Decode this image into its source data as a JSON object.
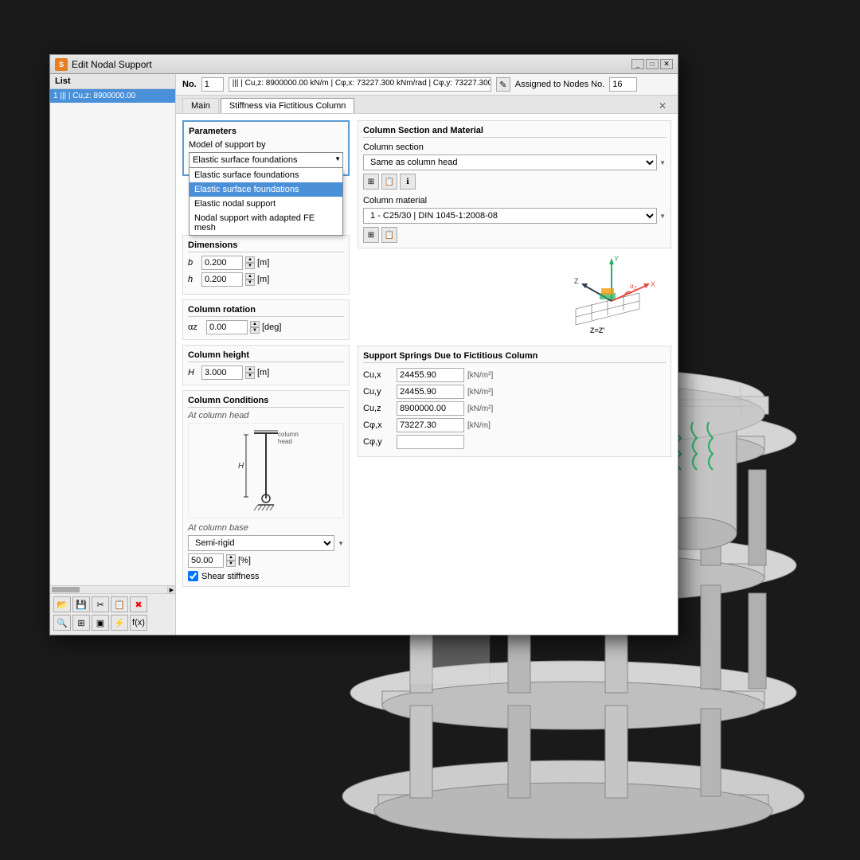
{
  "background": {
    "color": "#1a1a1a"
  },
  "dialog": {
    "title": "Edit Nodal Support",
    "title_icon": "S",
    "title_icon_color": "#e67e22"
  },
  "list": {
    "header": "List",
    "item": "1  |||  | Cu,z: 8900000.00"
  },
  "number_row": {
    "no_label": "No.",
    "no_value": "1",
    "name_value": "|||  | Cu,z: 8900000.00 kN/m | Cφ,x: 73227.300 kNm/rad | Cφ,y: 73227.300",
    "assigned_label": "Assigned to Nodes No.",
    "assigned_value": "16",
    "edit_icon": "✎"
  },
  "tabs": {
    "main_label": "Main",
    "stiffness_label": "Stiffness via Fictitious Column"
  },
  "parameters": {
    "title": "Parameters",
    "model_label": "Model of support by",
    "model_selected": "Elastic surface foundations",
    "model_options": [
      "Elastic surface foundations",
      "Elastic surface foundations",
      "Elastic nodal support",
      "Nodal support with adapted FE mesh"
    ],
    "model_option_selected_index": 1
  },
  "dimensions": {
    "title": "Dimensions",
    "b_label": "b",
    "b_value": "0.200",
    "b_unit": "[m]",
    "h_label": "h",
    "h_value": "0.200",
    "h_unit": "[m]"
  },
  "column_rotation": {
    "title": "Column rotation",
    "az_label": "αz",
    "az_value": "0.00",
    "az_unit": "[deg]"
  },
  "column_height": {
    "title": "Column height",
    "H_label": "H",
    "H_value": "3.000",
    "H_unit": "[m]"
  },
  "column_conditions": {
    "title": "Column Conditions",
    "at_head_label": "At column head",
    "at_base_label": "At column base",
    "base_type": "Semi-rigid",
    "base_percent": "50.00",
    "base_unit": "[%]",
    "shear_label": "Shear stiffness"
  },
  "column_section": {
    "title": "Column Section and Material",
    "section_label": "Column section",
    "section_value": "Same as column head",
    "material_label": "Column material",
    "material_value": "1 - C25/30 | DIN 1045-1:2008-08"
  },
  "support_springs": {
    "title": "Support Springs Due to Fictitious Column",
    "cu_x_label": "Cu,x",
    "cu_x_value": "24455.90",
    "cu_x_unit": "[kN/m²]",
    "cu_y_label": "Cu,y",
    "cu_y_value": "24455.90",
    "cu_y_unit": "[kN/m²]",
    "cu_z_label": "Cu,z",
    "cu_z_value": "8900000.00",
    "cu_z_unit": "[kN/m²]",
    "cphi_x_label": "Cφ,x",
    "cphi_x_value": "73227.30",
    "cphi_x_unit": "[kN/m]",
    "cphi_y_label": "Cφ,y"
  },
  "column_head_text": "column head",
  "toolbar_bottom": {
    "btns": [
      "📂",
      "💾",
      "✂",
      "📋",
      "✖",
      "🔍",
      "⊞",
      "▣",
      "⚡",
      "f(x)"
    ]
  },
  "axis_colors": {
    "x": "#e74c3c",
    "y": "#27ae60",
    "z": "#3498db",
    "alphaz": "#e74c3c"
  }
}
